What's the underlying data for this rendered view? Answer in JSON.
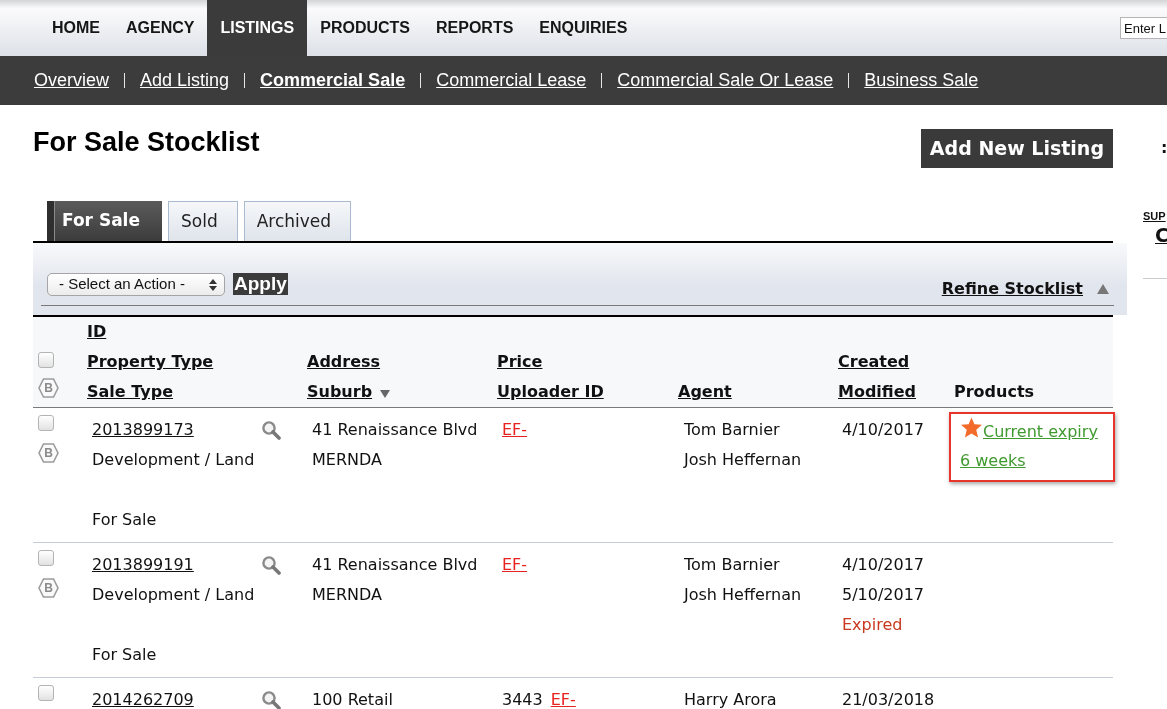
{
  "top_nav": {
    "items": [
      {
        "label": "HOME",
        "selected": false
      },
      {
        "label": "AGENCY",
        "selected": false
      },
      {
        "label": "LISTINGS",
        "selected": true
      },
      {
        "label": "PRODUCTS",
        "selected": false
      },
      {
        "label": "REPORTS",
        "selected": false
      },
      {
        "label": "ENQUIRIES",
        "selected": false
      }
    ],
    "search": {
      "placeholder": "Enter L"
    }
  },
  "sub_nav": {
    "links": [
      {
        "label": "Overview",
        "selected": false
      },
      {
        "label": "Add Listing",
        "selected": false
      },
      {
        "label": "Commercial Sale",
        "selected": true
      },
      {
        "label": "Commercial Lease",
        "selected": false
      },
      {
        "label": "Commercial Sale Or Lease",
        "selected": false
      },
      {
        "label": "Business Sale",
        "selected": false
      }
    ]
  },
  "page": {
    "title": "For Sale Stocklist",
    "add_button": "Add New Listing"
  },
  "side_panel": {
    "text_1": ":",
    "heading": "SUP",
    "link": "C"
  },
  "tabs": [
    {
      "label": "For Sale",
      "selected": true
    },
    {
      "label": "Sold",
      "selected": false
    },
    {
      "label": "Archived",
      "selected": false
    }
  ],
  "toolbar": {
    "action_select": "- Select an Action -",
    "apply_button": "Apply",
    "refine_link": "Refine Stocklist",
    "refine_expanded": true
  },
  "table": {
    "select_all": {
      "checked": false,
      "badge": "B"
    },
    "columns": [
      {
        "kind": "link",
        "labels": [
          {
            "text": "ID",
            "sorted": false
          },
          {
            "text": "Property Type",
            "sorted": false
          },
          {
            "text": "Sale Type",
            "sorted": false
          }
        ]
      },
      {
        "kind": "link",
        "labels": [
          {
            "text": "Address",
            "sorted": false
          },
          {
            "text": "Suburb",
            "sorted": true
          }
        ]
      },
      {
        "kind": "link",
        "labels": [
          {
            "text": "Price",
            "sorted": false
          },
          {
            "text": "Uploader ID",
            "sorted": false
          }
        ]
      },
      {
        "kind": "link",
        "labels": [
          {
            "text": "Agent",
            "sorted": false
          }
        ]
      },
      {
        "kind": "link",
        "labels": [
          {
            "text": "Created",
            "sorted": false
          },
          {
            "text": "Modified",
            "sorted": false
          }
        ]
      },
      {
        "kind": "plain",
        "labels": [
          {
            "text": "Products",
            "sorted": false
          }
        ]
      }
    ],
    "rows": [
      {
        "checked": false,
        "badge": "B",
        "id": "2013899173",
        "property_type": "Development / Land",
        "sale_type": "For Sale",
        "address": "41 Renaissance Blvd",
        "suburb": "MERNDA",
        "uploader_id": "EF-",
        "agents": [
          "Tom Barnier",
          "Josh Heffernan"
        ],
        "created": "4/10/2017",
        "products": [
          {
            "label": "Current expiry",
            "detail": "6 weeks",
            "highlighted": true
          }
        ]
      },
      {
        "checked": false,
        "badge": "B",
        "id": "2013899191",
        "property_type": "Development / Land",
        "sale_type": "For Sale",
        "address": "41 Renaissance Blvd",
        "suburb": "MERNDA",
        "uploader_id": "EF-",
        "agents": [
          "Tom Barnier",
          "Josh Heffernan"
        ],
        "created": "4/10/2017",
        "modified": "5/10/2017",
        "status": "Expired"
      },
      {
        "checked": false,
        "id": "2014262709",
        "address": "100 Retail",
        "price": "3443",
        "uploader_id": "EF-",
        "agents": [
          "Harry Arora"
        ],
        "created": "21/03/2018"
      }
    ]
  }
}
